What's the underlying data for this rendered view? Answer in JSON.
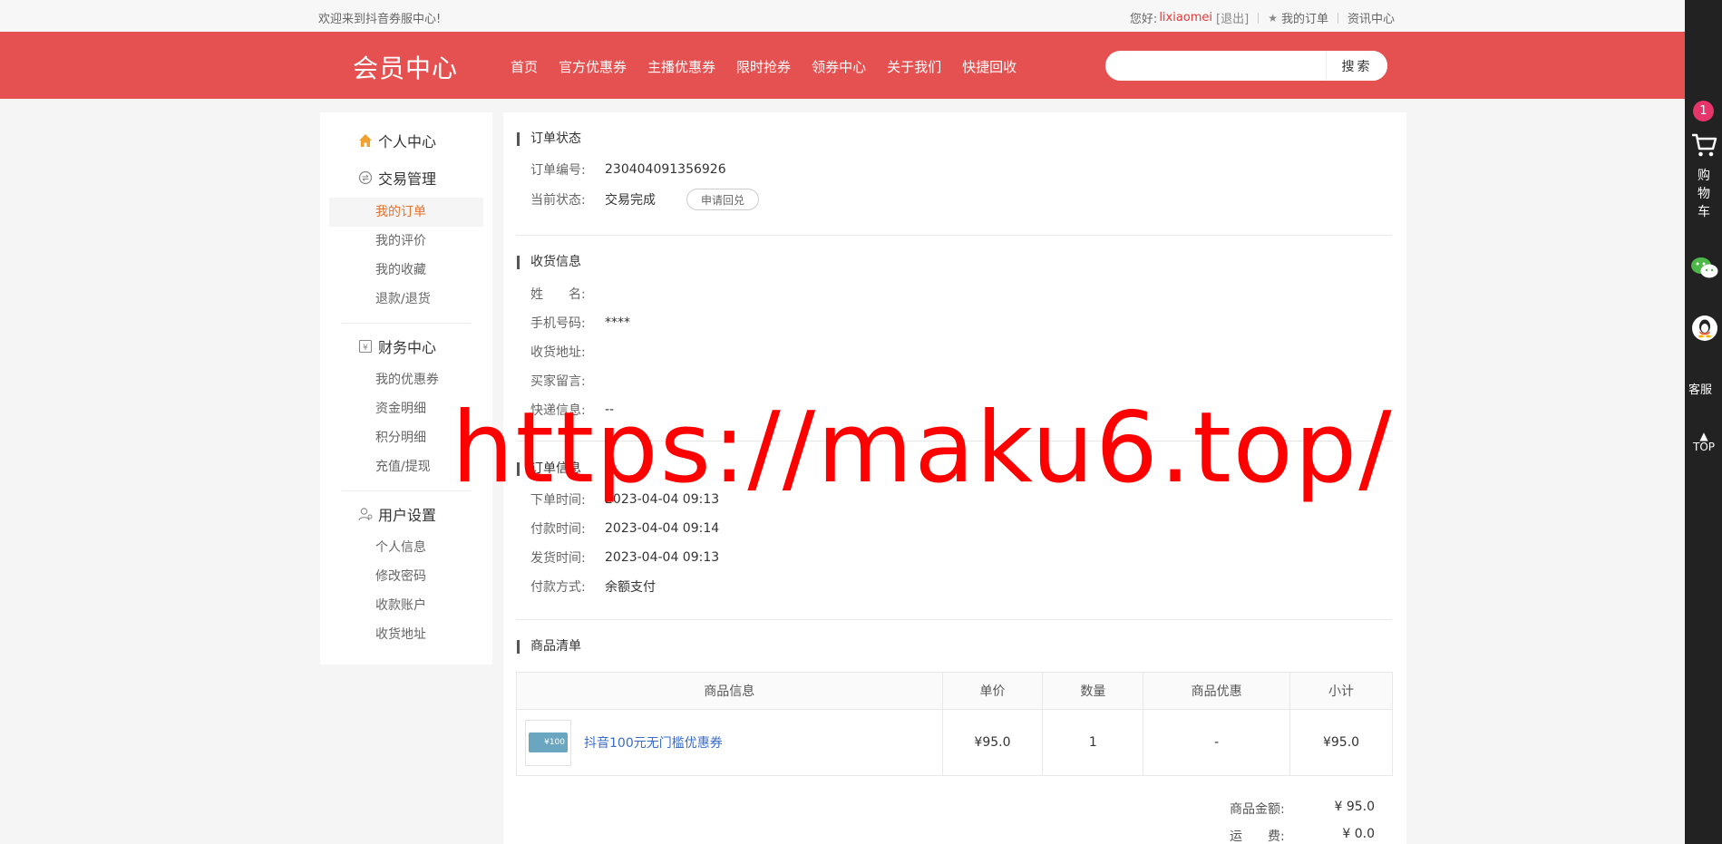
{
  "topbar": {
    "welcome": "欢迎来到抖音券服中心!",
    "hello": "您好:",
    "username": "lixiaomei",
    "logout": "[退出]",
    "my_orders": "我的订单",
    "news_center": "资讯中心"
  },
  "header": {
    "logo": "会员中心",
    "nav": [
      "首页",
      "官方优惠券",
      "主播优惠券",
      "限时抢券",
      "领券中心",
      "关于我们",
      "快捷回收"
    ],
    "search_placeholder": "",
    "search_button": "搜索"
  },
  "sidebar": {
    "groups": [
      {
        "title": "个人中心",
        "icon": "home-icon",
        "items": []
      },
      {
        "title": "交易管理",
        "icon": "exchange-icon",
        "items": [
          "我的订单",
          "我的评价",
          "我的收藏",
          "退款/退货"
        ]
      },
      {
        "title": "财务中心",
        "icon": "finance-icon",
        "items": [
          "我的优惠券",
          "资金明细",
          "积分明细",
          "充值/提现"
        ]
      },
      {
        "title": "用户设置",
        "icon": "user-icon",
        "items": [
          "个人信息",
          "修改密码",
          "收款账户",
          "收货地址"
        ]
      }
    ],
    "active_item": "我的订单"
  },
  "order_status": {
    "title": "订单状态",
    "order_no_label": "订单编号:",
    "order_no": "230404091356926",
    "status_label": "当前状态:",
    "status": "交易完成",
    "refund_button": "申请回兑"
  },
  "shipping": {
    "title": "收货信息",
    "name_label": "姓　　名:",
    "name": "",
    "phone_label": "手机号码:",
    "phone": "****",
    "address_label": "收货地址:",
    "address": "",
    "message_label": "买家留言:",
    "message": "",
    "express_label": "快递信息:",
    "express": "--"
  },
  "order_info": {
    "title": "订单信息",
    "order_time_label": "下单时间:",
    "order_time": "2023-04-04 09:13",
    "pay_time_label": "付款时间:",
    "pay_time": "2023-04-04 09:14",
    "ship_time_label": "发货时间:",
    "ship_time": "2023-04-04 09:13",
    "pay_method_label": "付款方式:",
    "pay_method": "余额支付"
  },
  "goods": {
    "title": "商品清单",
    "columns": [
      "商品信息",
      "单价",
      "数量",
      "商品优惠",
      "小计"
    ],
    "rows": [
      {
        "name": "抖音100元无门槛优惠券",
        "thumb_text": "¥100",
        "price": "¥95.0",
        "qty": "1",
        "discount": "-",
        "subtotal": "¥95.0"
      }
    ]
  },
  "totals": {
    "goods_amount_label": "商品金额:",
    "goods_amount": "¥ 95.0",
    "shipping_label": "运　　费:",
    "shipping": "¥ 0.0"
  },
  "rail": {
    "cart_count": "1",
    "cart_label": "购物车",
    "service_label": "客服",
    "top_label": "TOP"
  },
  "watermark": "https://maku6.top/"
}
